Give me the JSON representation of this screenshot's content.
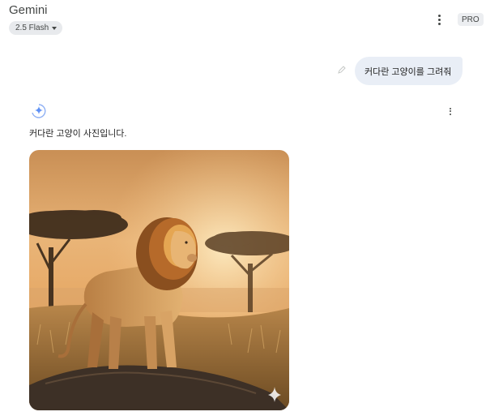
{
  "app": {
    "title": "Gemini",
    "model_label": "2.5 Flash",
    "badge": "PRO"
  },
  "icons": {
    "more_menu": "more-vertical-icon",
    "edit": "pencil-icon",
    "gemini": "gemini-sparkle-icon",
    "dropdown": "chevron-down-icon",
    "watermark": "sparkle-watermark-icon"
  },
  "colors": {
    "user_bubble_bg": "#e9eef6",
    "pill_bg": "#e8eaed",
    "gemini_blue": "#4285f4"
  },
  "conversation": {
    "user_message": "커다란 고양이를 그려줘",
    "response_text": "커다란 고양이 사진입니다.",
    "image_subject": "lion on rock in savanna at sunset"
  }
}
